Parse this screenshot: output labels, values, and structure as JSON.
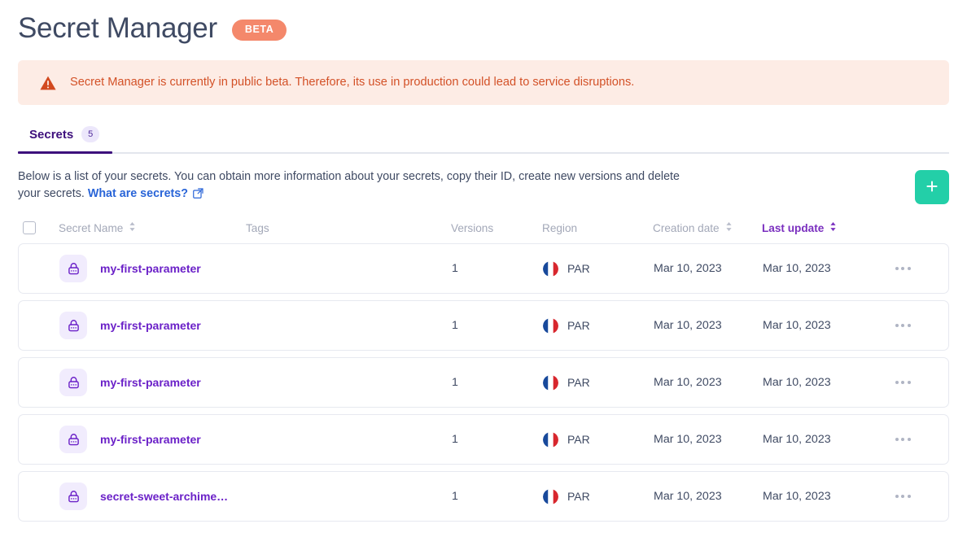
{
  "header": {
    "title": "Secret Manager",
    "badge": "BETA"
  },
  "alert": {
    "icon": "warning-triangle-icon",
    "text": "Secret Manager is currently in public beta. Therefore, its use in production could lead to service disruptions.",
    "bg_color": "#fdece5",
    "text_color": "#d35127"
  },
  "tabs": [
    {
      "label": "Secrets",
      "count": "5",
      "active": true
    }
  ],
  "description": {
    "text": "Below is a list of your secrets. You can obtain more information about your secrets, copy their ID, create new versions and delete your secrets.",
    "link_label": "What are secrets?",
    "link_icon": "external-link-icon"
  },
  "add_button": {
    "icon": "plus-icon",
    "color": "#23cfa8"
  },
  "table": {
    "select_all": {
      "icon": "checkbox-unchecked-icon"
    },
    "columns": [
      {
        "label": "Secret Name",
        "sortable": true,
        "sorted": false
      },
      {
        "label": "Tags",
        "sortable": false,
        "sorted": false
      },
      {
        "label": "Versions",
        "sortable": false,
        "sorted": false
      },
      {
        "label": "Region",
        "sortable": false,
        "sorted": false
      },
      {
        "label": "Creation date",
        "sortable": true,
        "sorted": false
      },
      {
        "label": "Last update",
        "sortable": true,
        "sorted": true
      }
    ],
    "rows": [
      {
        "icon": "padlock-icon",
        "name": "my-first-parameter",
        "tags": "",
        "versions": "1",
        "region_flag": "france-flag-icon",
        "region": "PAR",
        "creation_date": "Mar 10, 2023",
        "last_update": "Mar 10, 2023",
        "menu": "more-options-icon"
      },
      {
        "icon": "padlock-icon",
        "name": "my-first-parameter",
        "tags": "",
        "versions": "1",
        "region_flag": "france-flag-icon",
        "region": "PAR",
        "creation_date": "Mar 10, 2023",
        "last_update": "Mar 10, 2023",
        "menu": "more-options-icon"
      },
      {
        "icon": "padlock-icon",
        "name": "my-first-parameter",
        "tags": "",
        "versions": "1",
        "region_flag": "france-flag-icon",
        "region": "PAR",
        "creation_date": "Mar 10, 2023",
        "last_update": "Mar 10, 2023",
        "menu": "more-options-icon"
      },
      {
        "icon": "padlock-icon",
        "name": "my-first-parameter",
        "tags": "",
        "versions": "1",
        "region_flag": "france-flag-icon",
        "region": "PAR",
        "creation_date": "Mar 10, 2023",
        "last_update": "Mar 10, 2023",
        "menu": "more-options-icon"
      },
      {
        "icon": "padlock-icon",
        "name": "secret-sweet-archime…",
        "tags": "",
        "versions": "1",
        "region_flag": "france-flag-icon",
        "region": "PAR",
        "creation_date": "Mar 10, 2023",
        "last_update": "Mar 10, 2023",
        "menu": "more-options-icon"
      }
    ]
  },
  "colors": {
    "brand_purple": "#3d0f7c",
    "accent_teal": "#23cfa8",
    "badge_orange": "#f4886b",
    "link_blue": "#2a65d8",
    "secret_purple": "#6b21c8"
  }
}
